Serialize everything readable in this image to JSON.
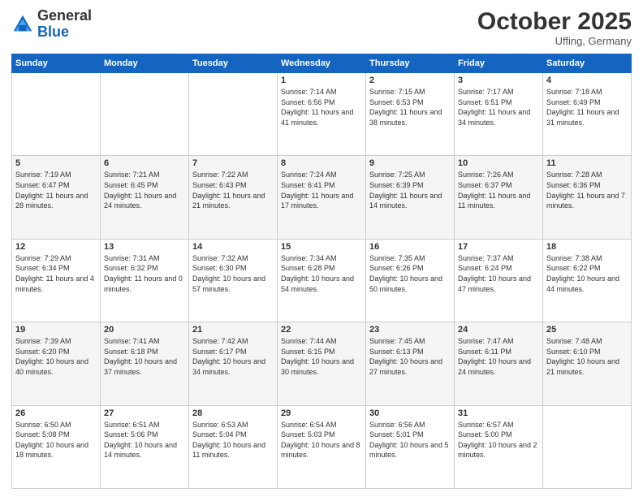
{
  "header": {
    "logo_general": "General",
    "logo_blue": "Blue",
    "month": "October 2025",
    "location": "Uffing, Germany"
  },
  "days_of_week": [
    "Sunday",
    "Monday",
    "Tuesday",
    "Wednesday",
    "Thursday",
    "Friday",
    "Saturday"
  ],
  "weeks": [
    [
      {
        "day": "",
        "sunrise": "",
        "sunset": "",
        "daylight": ""
      },
      {
        "day": "",
        "sunrise": "",
        "sunset": "",
        "daylight": ""
      },
      {
        "day": "",
        "sunrise": "",
        "sunset": "",
        "daylight": ""
      },
      {
        "day": "1",
        "sunrise": "Sunrise: 7:14 AM",
        "sunset": "Sunset: 6:56 PM",
        "daylight": "Daylight: 11 hours and 41 minutes."
      },
      {
        "day": "2",
        "sunrise": "Sunrise: 7:15 AM",
        "sunset": "Sunset: 6:53 PM",
        "daylight": "Daylight: 11 hours and 38 minutes."
      },
      {
        "day": "3",
        "sunrise": "Sunrise: 7:17 AM",
        "sunset": "Sunset: 6:51 PM",
        "daylight": "Daylight: 11 hours and 34 minutes."
      },
      {
        "day": "4",
        "sunrise": "Sunrise: 7:18 AM",
        "sunset": "Sunset: 6:49 PM",
        "daylight": "Daylight: 11 hours and 31 minutes."
      }
    ],
    [
      {
        "day": "5",
        "sunrise": "Sunrise: 7:19 AM",
        "sunset": "Sunset: 6:47 PM",
        "daylight": "Daylight: 11 hours and 28 minutes."
      },
      {
        "day": "6",
        "sunrise": "Sunrise: 7:21 AM",
        "sunset": "Sunset: 6:45 PM",
        "daylight": "Daylight: 11 hours and 24 minutes."
      },
      {
        "day": "7",
        "sunrise": "Sunrise: 7:22 AM",
        "sunset": "Sunset: 6:43 PM",
        "daylight": "Daylight: 11 hours and 21 minutes."
      },
      {
        "day": "8",
        "sunrise": "Sunrise: 7:24 AM",
        "sunset": "Sunset: 6:41 PM",
        "daylight": "Daylight: 11 hours and 17 minutes."
      },
      {
        "day": "9",
        "sunrise": "Sunrise: 7:25 AM",
        "sunset": "Sunset: 6:39 PM",
        "daylight": "Daylight: 11 hours and 14 minutes."
      },
      {
        "day": "10",
        "sunrise": "Sunrise: 7:26 AM",
        "sunset": "Sunset: 6:37 PM",
        "daylight": "Daylight: 11 hours and 11 minutes."
      },
      {
        "day": "11",
        "sunrise": "Sunrise: 7:28 AM",
        "sunset": "Sunset: 6:36 PM",
        "daylight": "Daylight: 11 hours and 7 minutes."
      }
    ],
    [
      {
        "day": "12",
        "sunrise": "Sunrise: 7:29 AM",
        "sunset": "Sunset: 6:34 PM",
        "daylight": "Daylight: 11 hours and 4 minutes."
      },
      {
        "day": "13",
        "sunrise": "Sunrise: 7:31 AM",
        "sunset": "Sunset: 6:32 PM",
        "daylight": "Daylight: 11 hours and 0 minutes."
      },
      {
        "day": "14",
        "sunrise": "Sunrise: 7:32 AM",
        "sunset": "Sunset: 6:30 PM",
        "daylight": "Daylight: 10 hours and 57 minutes."
      },
      {
        "day": "15",
        "sunrise": "Sunrise: 7:34 AM",
        "sunset": "Sunset: 6:28 PM",
        "daylight": "Daylight: 10 hours and 54 minutes."
      },
      {
        "day": "16",
        "sunrise": "Sunrise: 7:35 AM",
        "sunset": "Sunset: 6:26 PM",
        "daylight": "Daylight: 10 hours and 50 minutes."
      },
      {
        "day": "17",
        "sunrise": "Sunrise: 7:37 AM",
        "sunset": "Sunset: 6:24 PM",
        "daylight": "Daylight: 10 hours and 47 minutes."
      },
      {
        "day": "18",
        "sunrise": "Sunrise: 7:38 AM",
        "sunset": "Sunset: 6:22 PM",
        "daylight": "Daylight: 10 hours and 44 minutes."
      }
    ],
    [
      {
        "day": "19",
        "sunrise": "Sunrise: 7:39 AM",
        "sunset": "Sunset: 6:20 PM",
        "daylight": "Daylight: 10 hours and 40 minutes."
      },
      {
        "day": "20",
        "sunrise": "Sunrise: 7:41 AM",
        "sunset": "Sunset: 6:18 PM",
        "daylight": "Daylight: 10 hours and 37 minutes."
      },
      {
        "day": "21",
        "sunrise": "Sunrise: 7:42 AM",
        "sunset": "Sunset: 6:17 PM",
        "daylight": "Daylight: 10 hours and 34 minutes."
      },
      {
        "day": "22",
        "sunrise": "Sunrise: 7:44 AM",
        "sunset": "Sunset: 6:15 PM",
        "daylight": "Daylight: 10 hours and 30 minutes."
      },
      {
        "day": "23",
        "sunrise": "Sunrise: 7:45 AM",
        "sunset": "Sunset: 6:13 PM",
        "daylight": "Daylight: 10 hours and 27 minutes."
      },
      {
        "day": "24",
        "sunrise": "Sunrise: 7:47 AM",
        "sunset": "Sunset: 6:11 PM",
        "daylight": "Daylight: 10 hours and 24 minutes."
      },
      {
        "day": "25",
        "sunrise": "Sunrise: 7:48 AM",
        "sunset": "Sunset: 6:10 PM",
        "daylight": "Daylight: 10 hours and 21 minutes."
      }
    ],
    [
      {
        "day": "26",
        "sunrise": "Sunrise: 6:50 AM",
        "sunset": "Sunset: 5:08 PM",
        "daylight": "Daylight: 10 hours and 18 minutes."
      },
      {
        "day": "27",
        "sunrise": "Sunrise: 6:51 AM",
        "sunset": "Sunset: 5:06 PM",
        "daylight": "Daylight: 10 hours and 14 minutes."
      },
      {
        "day": "28",
        "sunrise": "Sunrise: 6:53 AM",
        "sunset": "Sunset: 5:04 PM",
        "daylight": "Daylight: 10 hours and 11 minutes."
      },
      {
        "day": "29",
        "sunrise": "Sunrise: 6:54 AM",
        "sunset": "Sunset: 5:03 PM",
        "daylight": "Daylight: 10 hours and 8 minutes."
      },
      {
        "day": "30",
        "sunrise": "Sunrise: 6:56 AM",
        "sunset": "Sunset: 5:01 PM",
        "daylight": "Daylight: 10 hours and 5 minutes."
      },
      {
        "day": "31",
        "sunrise": "Sunrise: 6:57 AM",
        "sunset": "Sunset: 5:00 PM",
        "daylight": "Daylight: 10 hours and 2 minutes."
      },
      {
        "day": "",
        "sunrise": "",
        "sunset": "",
        "daylight": ""
      }
    ]
  ]
}
